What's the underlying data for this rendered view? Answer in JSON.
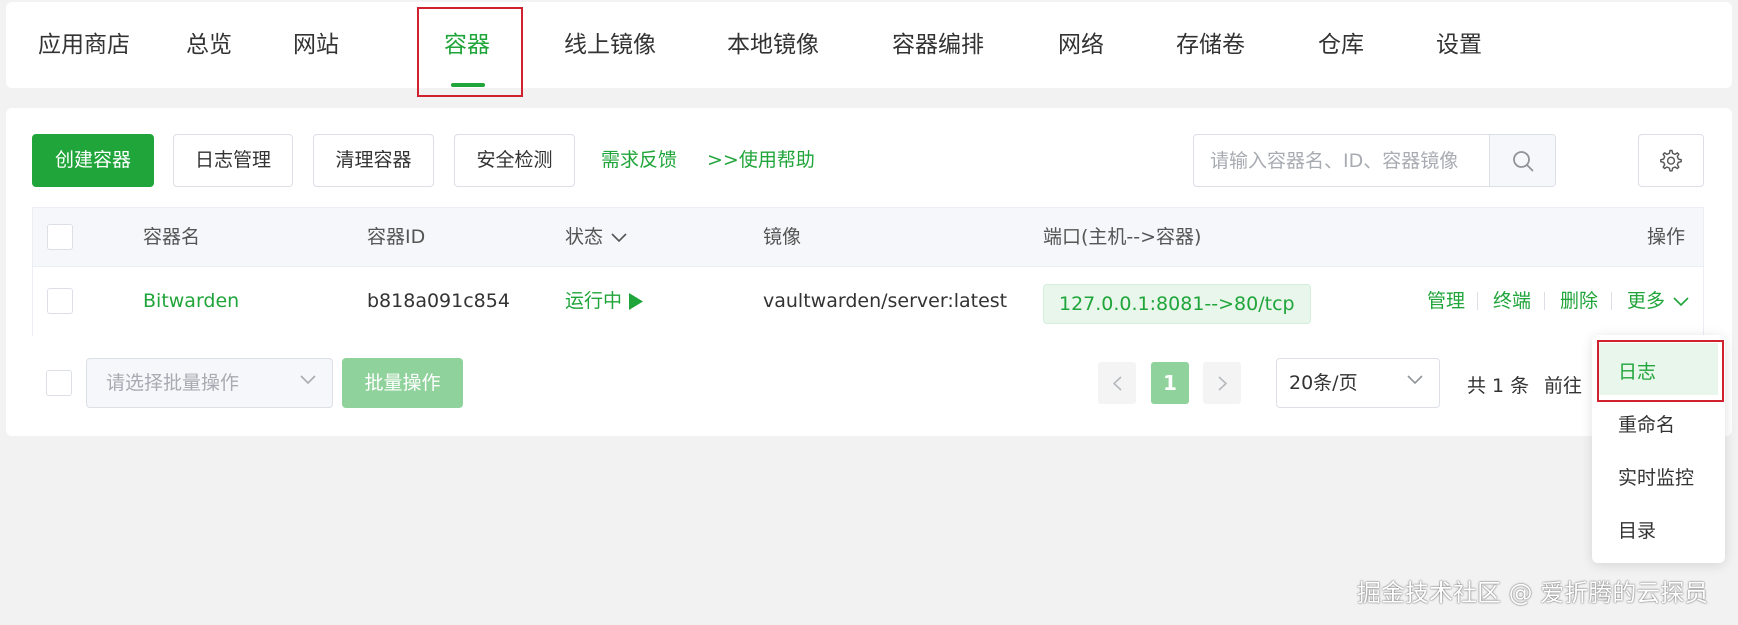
{
  "nav": {
    "tabs": [
      {
        "label": "应用商店"
      },
      {
        "label": "总览"
      },
      {
        "label": "网站"
      },
      {
        "label": "容器"
      },
      {
        "label": "线上镜像"
      },
      {
        "label": "本地镜像"
      },
      {
        "label": "容器编排"
      },
      {
        "label": "网络"
      },
      {
        "label": "存储卷"
      },
      {
        "label": "仓库"
      },
      {
        "label": "设置"
      }
    ],
    "active": "容器"
  },
  "toolbar": {
    "create_label": "创建容器",
    "log_manage_label": "日志管理",
    "clean_label": "清理容器",
    "security_label": "安全检测",
    "feedback_label": "需求反馈",
    "help_label": ">>使用帮助",
    "search_placeholder": "请输入容器名、ID、容器镜像"
  },
  "table": {
    "headers": {
      "name": "容器名",
      "id": "容器ID",
      "status": "状态",
      "image": "镜像",
      "port": "端口(主机-->容器)",
      "ops": "操作"
    },
    "rows": [
      {
        "name": "Bitwarden",
        "id": "b818a091c854",
        "status": "运行中",
        "image": "vaultwarden/server:latest",
        "port": "127.0.0.1:8081-->80/tcp",
        "ops": [
          "管理",
          "终端",
          "删除",
          "更多"
        ]
      }
    ]
  },
  "footer": {
    "batch_select_placeholder": "请选择批量操作",
    "batch_button": "批量操作",
    "current_page": "1",
    "page_size": "20条/页",
    "total": "共 1 条",
    "goto": "前往"
  },
  "dropdown": {
    "items": [
      "日志",
      "重命名",
      "实时监控",
      "目录"
    ]
  },
  "watermark": "掘金技术社区 @ 爱折腾的云探员",
  "colors": {
    "accent": "#20a53a",
    "accent_light": "#90d29c",
    "highlight_box": "#d0222e"
  }
}
